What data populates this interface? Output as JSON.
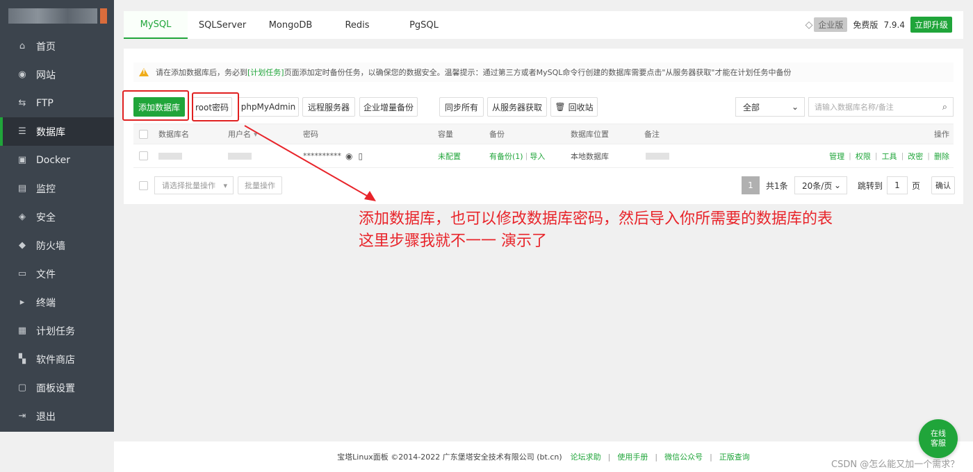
{
  "sidebar": {
    "items": [
      {
        "label": "首页",
        "icon": "home-icon"
      },
      {
        "label": "网站",
        "icon": "globe-icon"
      },
      {
        "label": "FTP",
        "icon": "ftp-icon"
      },
      {
        "label": "数据库",
        "icon": "database-icon",
        "active": true
      },
      {
        "label": "Docker",
        "icon": "docker-icon"
      },
      {
        "label": "监控",
        "icon": "monitor-icon"
      },
      {
        "label": "安全",
        "icon": "shield-icon"
      },
      {
        "label": "防火墙",
        "icon": "firewall-icon"
      },
      {
        "label": "文件",
        "icon": "folder-icon"
      },
      {
        "label": "终端",
        "icon": "terminal-icon"
      },
      {
        "label": "计划任务",
        "icon": "calendar-icon"
      },
      {
        "label": "软件商店",
        "icon": "apps-icon"
      },
      {
        "label": "面板设置",
        "icon": "settings-icon"
      },
      {
        "label": "退出",
        "icon": "logout-icon"
      }
    ]
  },
  "tabs": [
    "MySQL",
    "SQLServer",
    "MongoDB",
    "Redis",
    "PgSQL"
  ],
  "header": {
    "enterprise": "企业版",
    "free": "免费版",
    "version": "7.9.4",
    "upgrade": "立即升级"
  },
  "notice": {
    "pre": "请在添加数据库后，务必到",
    "link": "[计划任务]",
    "post": "页面添加定时备份任务，以确保您的数据安全。温馨提示：通过第三方或者MySQL命令行创建的数据库需要点击\"从服务器获取\"才能在计划任务中备份"
  },
  "toolbar": {
    "add_db": "添加数据库",
    "root_pw": "root密码",
    "phpmyadmin": "phpMyAdmin",
    "remote": "远程服务器",
    "ent_backup": "企业增量备份",
    "sync_all": "同步所有",
    "fetch": "从服务器获取",
    "recycle": "回收站",
    "filter": "全部",
    "search_placeholder": "请输入数据库名称/备注"
  },
  "table": {
    "headers": {
      "name": "数据库名",
      "user": "用户名",
      "password": "密码",
      "capacity": "容量",
      "backup": "备份",
      "location": "数据库位置",
      "note": "备注",
      "ops": "操作"
    },
    "row": {
      "password": "**********",
      "capacity": "未配置",
      "backup": "有备份(1)",
      "import": "导入",
      "location": "本地数据库",
      "ops": [
        "管理",
        "权限",
        "工具",
        "改密",
        "删除"
      ]
    }
  },
  "batch": {
    "select": "请选择批量操作",
    "button": "批量操作"
  },
  "pagination": {
    "page": "1",
    "total": "共1条",
    "per_page": "20条/页",
    "goto": "跳转到",
    "goto_value": "1",
    "page_unit": "页",
    "confirm": "确认"
  },
  "annotation": {
    "line1": "添加数据库，也可以修改数据库密码，然后导入你所需要的数据库的表",
    "line2": "这里步骤我就不一一 演示了"
  },
  "footer": {
    "copyright": "宝塔Linux面板 ©2014-2022 广东堡塔安全技术有限公司 (bt.cn)",
    "links": [
      "论坛求助",
      "使用手册",
      "微信公众号",
      "正版查询"
    ]
  },
  "chat": {
    "line1": "在线",
    "line2": "客服"
  },
  "watermark": "CSDN @怎么能又加一个需求？",
  "colors": {
    "accent": "#20a53a",
    "sidebar": "#3c444d",
    "highlight": "#e02020"
  }
}
